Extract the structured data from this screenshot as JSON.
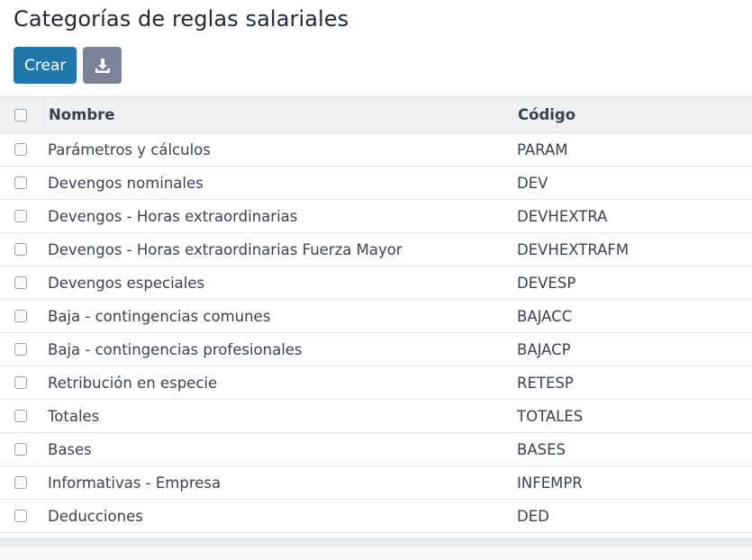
{
  "page": {
    "title": "Categorías de reglas salariales"
  },
  "toolbar": {
    "create_label": "Crear",
    "download_icon": "download-icon"
  },
  "table": {
    "columns": {
      "name": "Nombre",
      "code": "Código"
    },
    "rows": [
      {
        "name": "Parámetros y cálculos",
        "code": "PARAM"
      },
      {
        "name": "Devengos nominales",
        "code": "DEV"
      },
      {
        "name": "Devengos - Horas extraordinarias",
        "code": "DEVHEXTRA"
      },
      {
        "name": "Devengos - Horas extraordinarias Fuerza Mayor",
        "code": "DEVHEXTRAFM"
      },
      {
        "name": "Devengos especiales",
        "code": "DEVESP"
      },
      {
        "name": "Baja - contingencias comunes",
        "code": "BAJACC"
      },
      {
        "name": "Baja - contingencias profesionales",
        "code": "BAJACP"
      },
      {
        "name": "Retribución en especie",
        "code": "RETESP"
      },
      {
        "name": "Totales",
        "code": "TOTALES"
      },
      {
        "name": "Bases",
        "code": "BASES"
      },
      {
        "name": "Informativas - Empresa",
        "code": "INFEMPR"
      },
      {
        "name": "Deducciones",
        "code": "DED"
      }
    ]
  },
  "colors": {
    "primary": "#1f77ab",
    "secondary": "#7c8397",
    "header_bg": "#f0f1f2"
  }
}
